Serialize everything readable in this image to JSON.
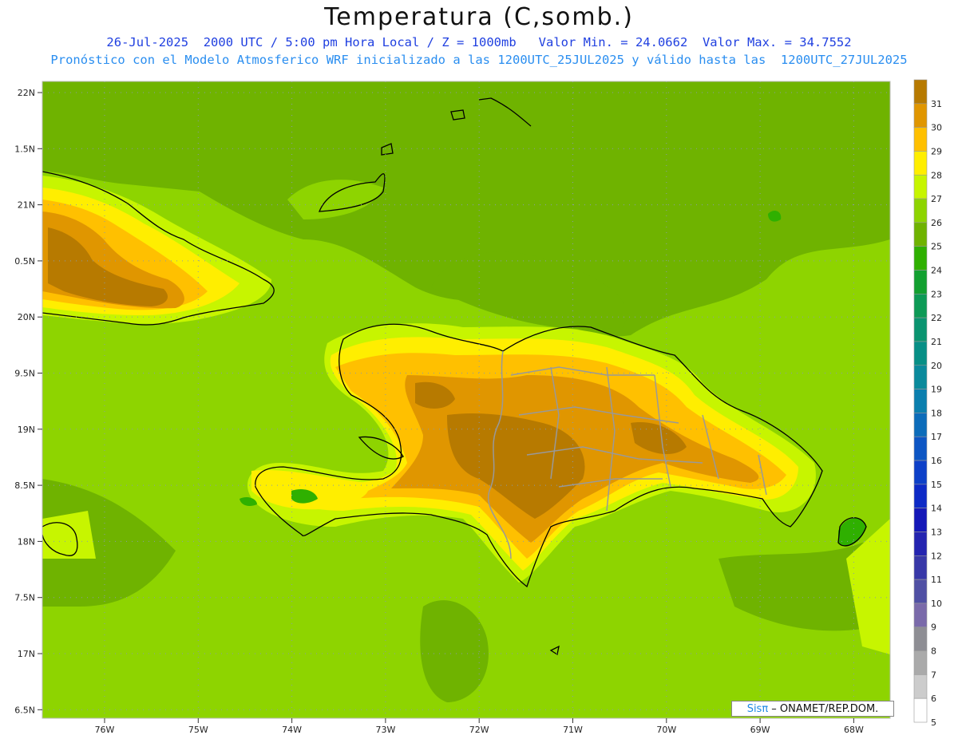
{
  "header": {
    "title": "Temperatura (C,somb.)",
    "subtitle_line1": "26-Jul-2025  2000 UTC / 5:00 pm Hora Local / Z = 1000mb   Valor Min. = 24.0662  Valor Max. = 34.7552",
    "subtitle_line2": "Pronóstico con el Modelo Atmosferico WRF inicializado a las 1200UTC_25JUL2025 y válido hasta las  1200UTC_27JUL2025"
  },
  "map": {
    "lat_labels": [
      "22N",
      "1.5N",
      "21N",
      "0.5N",
      "20N",
      "9.5N",
      "19N",
      "8.5N",
      "18N",
      "7.5N",
      "17N",
      "6.5N"
    ],
    "lon_labels": [
      "76W",
      "75W",
      "74W",
      "73W",
      "72W",
      "71W",
      "70W",
      "69W",
      "68W"
    ],
    "grid_dotted": true
  },
  "colorbar": {
    "levels": [
      "31",
      "30",
      "29",
      "28",
      "27",
      "26",
      "25",
      "24",
      "23",
      "22",
      "21",
      "20",
      "19",
      "18",
      "17",
      "16",
      "15",
      "14",
      "13",
      "12",
      "11",
      "10",
      "9",
      "8",
      "7",
      "6",
      "5"
    ],
    "colors": [
      "#b77a00",
      "#e09600",
      "#ffc000",
      "#ffee00",
      "#c7f500",
      "#8ed400",
      "#6fb300",
      "#2fb000",
      "#12a030",
      "#0d9a56",
      "#0a9470",
      "#078f86",
      "#0a8a9c",
      "#0b7fae",
      "#0c6cba",
      "#0d56c4",
      "#0d40c8",
      "#0d2ac6",
      "#1518b8",
      "#2424b0",
      "#3838a8",
      "#5050a4",
      "#7a6aaa",
      "#8e8e94",
      "#aaaaaa",
      "#cccccc",
      "#ffffff"
    ]
  },
  "credit": {
    "logo": "Sisπ",
    "text": " – ONAMET/REP.DOM."
  }
}
